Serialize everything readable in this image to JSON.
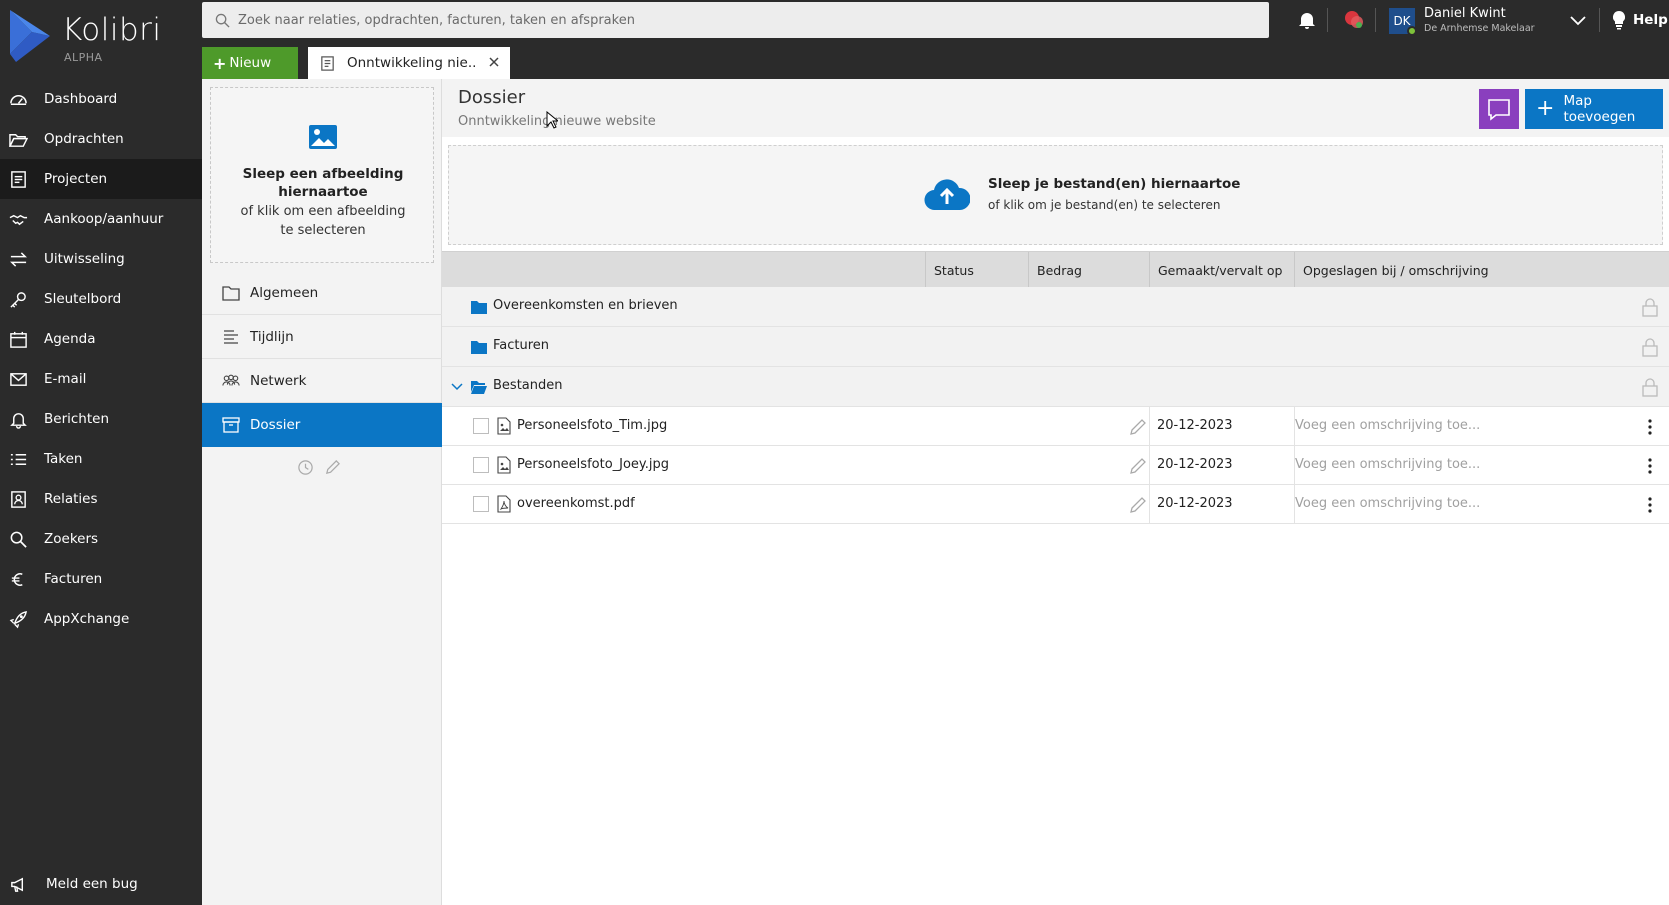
{
  "app": {
    "name": "Kolibri",
    "edition": "ALPHA"
  },
  "colors": {
    "nav_bg": "#2b2b2b",
    "accent_blue": "#0b76c5",
    "new_green": "#4e9a2a",
    "chat_purple": "#8a3fbe"
  },
  "nav": {
    "items": [
      {
        "label": "Dashboard",
        "icon": "dashboard-icon"
      },
      {
        "label": "Opdrachten",
        "icon": "folder-open-icon"
      },
      {
        "label": "Projecten",
        "icon": "projects-icon",
        "active": true
      },
      {
        "label": "Aankoop/aanhuur",
        "icon": "handshake-icon"
      },
      {
        "label": "Uitwisseling",
        "icon": "exchange-icon"
      },
      {
        "label": "Sleutelbord",
        "icon": "key-icon"
      },
      {
        "label": "Agenda",
        "icon": "calendar-icon"
      },
      {
        "label": "E-mail",
        "icon": "mail-icon"
      },
      {
        "label": "Berichten",
        "icon": "bell-outline-icon"
      },
      {
        "label": "Taken",
        "icon": "tasks-icon"
      },
      {
        "label": "Relaties",
        "icon": "contacts-icon"
      },
      {
        "label": "Zoekers",
        "icon": "search-icon"
      },
      {
        "label": "Facturen",
        "icon": "euro-icon"
      },
      {
        "label": "AppXchange",
        "icon": "rocket-icon"
      }
    ],
    "bug_label": "Meld een bug"
  },
  "topbar": {
    "search_placeholder": "Zoek naar relaties, opdrachten, facturen, taken en afspraken",
    "user": {
      "initials": "DK",
      "name": "Daniel Kwint",
      "company": "De Arnhemse Makelaar"
    },
    "help_label": "Help",
    "new_label": "Nieuw",
    "tab_label": "Onntwikkeling nie..."
  },
  "sidebar": {
    "image_drop_title": "Sleep een afbeelding hiernaartoe",
    "image_drop_sub": "of klik om een afbeelding te selecteren",
    "items": [
      {
        "label": "Algemeen",
        "icon": "folder-outline-icon"
      },
      {
        "label": "Tijdlijn",
        "icon": "timeline-icon"
      },
      {
        "label": "Netwerk",
        "icon": "network-icon"
      },
      {
        "label": "Dossier",
        "icon": "archive-icon",
        "active": true
      }
    ]
  },
  "main": {
    "title": "Dossier",
    "subtitle": "Onntwikkeling nieuwe website",
    "add_folder_label": "Map toevoegen",
    "file_drop_title": "Sleep je bestand(en) hiernaartoe",
    "file_drop_sub": "of klik om je bestand(en) te selecteren",
    "columns": [
      "Status",
      "Bedrag",
      "Gemaakt/vervalt op",
      "Opgeslagen bij / omschrijving"
    ],
    "folders": [
      {
        "name": "Overeenkomsten en brieven",
        "expanded": false
      },
      {
        "name": "Facturen",
        "expanded": false
      },
      {
        "name": "Bestanden",
        "expanded": true
      }
    ],
    "files": [
      {
        "name": "Personeelsfoto_Tim.jpg",
        "type": "image",
        "date": "20-12-2023",
        "desc_placeholder": "Voeg een omschrijving toe..."
      },
      {
        "name": "Personeelsfoto_Joey.jpg",
        "type": "image",
        "date": "20-12-2023",
        "desc_placeholder": "Voeg een omschrijving toe..."
      },
      {
        "name": "overeenkomst.pdf",
        "type": "pdf",
        "date": "20-12-2023",
        "desc_placeholder": "Voeg een omschrijving toe..."
      }
    ]
  }
}
